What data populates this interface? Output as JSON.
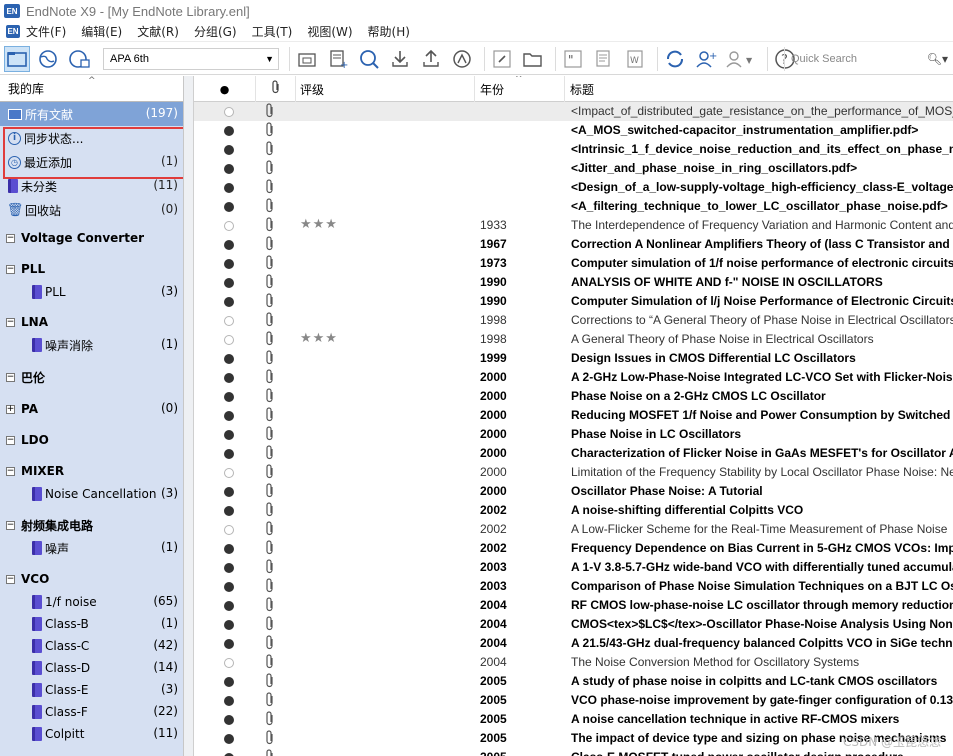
{
  "window": {
    "title": "EndNote X9 - [My EndNote Library.enl]",
    "icon_text": "EN"
  },
  "menu": [
    "文件(F)",
    "编辑(E)",
    "文献(R)",
    "分组(G)",
    "工具(T)",
    "视图(W)",
    "帮助(H)"
  ],
  "toolbar": {
    "style": "APA 6th",
    "search_placeholder": "Quick Search",
    "icons": [
      "local-library-icon",
      "online-search-icon",
      "integrated-library-icon",
      "new-group-icon",
      "new-reference-icon",
      "online-search-tool-icon",
      "import-icon",
      "export-icon",
      "find-fulltext-icon",
      "open-link-icon",
      "open-file-icon",
      "insert-citation-icon",
      "format-bibliography-icon",
      "word-icon",
      "sync-icon",
      "share-icon",
      "share-group-icon",
      "help-icon",
      "search-icon"
    ]
  },
  "sidebar": {
    "header": "我的库",
    "top_groups": [
      {
        "label": "所有文献",
        "count": "(197)",
        "icon": "library-icon"
      },
      {
        "label": "同步状态...",
        "count": "",
        "icon": "info-icon"
      },
      {
        "label": "最近添加",
        "count": "(1)",
        "icon": "clock-icon"
      },
      {
        "label": "未分类",
        "count": "(11)",
        "icon": "book-icon"
      },
      {
        "label": "回收站",
        "count": "(0)",
        "icon": "trash-icon"
      }
    ],
    "sets": [
      {
        "label": "Voltage Converter",
        "count": "",
        "expander": "−",
        "children": []
      },
      {
        "label": "PLL",
        "count": "",
        "expander": "−",
        "children": [
          {
            "label": "PLL",
            "count": "(3)"
          }
        ]
      },
      {
        "label": "LNA",
        "count": "",
        "expander": "−",
        "children": [
          {
            "label": "噪声消除",
            "count": "(1)"
          }
        ]
      },
      {
        "label": "巴伦",
        "count": "",
        "expander": "−",
        "children": []
      },
      {
        "label": "PA",
        "count": "(0)",
        "expander": "+",
        "children": []
      },
      {
        "label": "LDO",
        "count": "",
        "expander": "−",
        "children": []
      },
      {
        "label": "MIXER",
        "count": "",
        "expander": "−",
        "children": [
          {
            "label": "Noise Cancellation",
            "count": "(3)"
          }
        ]
      },
      {
        "label": "射频集成电路",
        "count": "",
        "expander": "−",
        "children": [
          {
            "label": "噪声",
            "count": "(1)"
          }
        ]
      },
      {
        "label": "VCO",
        "count": "",
        "expander": "−",
        "children": [
          {
            "label": "1/f noise",
            "count": "(65)"
          },
          {
            "label": "Class-B",
            "count": "(1)"
          },
          {
            "label": "Class-C",
            "count": "(42)"
          },
          {
            "label": "Class-D",
            "count": "(14)"
          },
          {
            "label": "Class-E",
            "count": "(3)"
          },
          {
            "label": "Class-F",
            "count": "(22)"
          },
          {
            "label": "Colpitt",
            "count": "(11)"
          }
        ]
      }
    ]
  },
  "list": {
    "columns": {
      "read": "●",
      "attachment": "📎",
      "rating": "评级",
      "year": "年份",
      "title": "标题"
    },
    "rows": [
      {
        "read": false,
        "rating": "",
        "year": "",
        "title": "<Impact_of_distributed_gate_resistance_on_the_performance_of_MOS_de",
        "bold": false
      },
      {
        "read": true,
        "rating": "",
        "year": "",
        "title": "<A_MOS_switched-capacitor_instrumentation_amplifier.pdf>",
        "bold": true
      },
      {
        "read": true,
        "rating": "",
        "year": "",
        "title": "<Intrinsic_1_f_device_noise_reduction_and_its_effect_on_phase_noise",
        "bold": true
      },
      {
        "read": true,
        "rating": "",
        "year": "",
        "title": "<Jitter_and_phase_noise_in_ring_oscillators.pdf>",
        "bold": true
      },
      {
        "read": true,
        "rating": "",
        "year": "",
        "title": "<Design_of_a_low-supply-voltage_high-efficiency_class-E_voltage-con",
        "bold": true
      },
      {
        "read": true,
        "rating": "",
        "year": "",
        "title": "<A_filtering_technique_to_lower_LC_oscillator_phase_noise.pdf>",
        "bold": true
      },
      {
        "read": false,
        "rating": "★★★",
        "year": "1933",
        "title": "The Interdependence of Frequency Variation and Harmonic Content and",
        "bold": false
      },
      {
        "read": true,
        "rating": "",
        "year": "1967",
        "title": "Correction A Nonlinear Amplifiers Theory of (lass C Transistor and Fre",
        "bold": true
      },
      {
        "read": true,
        "rating": "",
        "year": "1973",
        "title": "Computer simulation of 1/f noise performance of electronic circuits",
        "bold": true
      },
      {
        "read": true,
        "rating": "",
        "year": "1990",
        "title": "ANALYSIS OF WHITE AND f-\" NOISE IN OSCILLATORS",
        "bold": true
      },
      {
        "read": true,
        "rating": "",
        "year": "1990",
        "title": "Computer Simulation of l/j Noise Performance of Electronic Circuits",
        "bold": true
      },
      {
        "read": false,
        "rating": "",
        "year": "1998",
        "title": "Corrections to “A General Theory of Phase Noise in Electrical Oscillators”",
        "bold": false
      },
      {
        "read": false,
        "rating": "★★★",
        "year": "1998",
        "title": "A General Theory of Phase Noise in Electrical Oscillators",
        "bold": false
      },
      {
        "read": true,
        "rating": "",
        "year": "1999",
        "title": "Design Issues in CMOS Differential LC Oscillators",
        "bold": true
      },
      {
        "read": true,
        "rating": "",
        "year": "2000",
        "title": "A 2-GHz Low-Phase-Noise Integrated LC-VCO Set with Flicker-Noise",
        "bold": true
      },
      {
        "read": true,
        "rating": "",
        "year": "2000",
        "title": "Phase Noise on a 2-GHz CMOS LC Oscillator",
        "bold": true
      },
      {
        "read": true,
        "rating": "",
        "year": "2000",
        "title": "Reducing MOSFET 1/f Noise and Power Consumption by Switched Bia",
        "bold": true
      },
      {
        "read": true,
        "rating": "",
        "year": "2000",
        "title": "Phase Noise in LC Oscillators",
        "bold": true
      },
      {
        "read": true,
        "rating": "",
        "year": "2000",
        "title": "Characterization of Flicker Noise in GaAs MESFET's for Oscillator Appli",
        "bold": true
      },
      {
        "read": false,
        "rating": "",
        "year": "2000",
        "title": "Limitation of the Frequency Stability by Local Oscillator Phase Noise: New",
        "bold": false
      },
      {
        "read": true,
        "rating": "",
        "year": "2000",
        "title": "Oscillator Phase Noise: A Tutorial",
        "bold": true
      },
      {
        "read": true,
        "rating": "",
        "year": "2002",
        "title": "A noise-shifting differential Colpitts VCO",
        "bold": true
      },
      {
        "read": false,
        "rating": "",
        "year": "2002",
        "title": "A Low-Flicker Scheme for the Real-Time Measurement of Phase Noise",
        "bold": false
      },
      {
        "read": true,
        "rating": "",
        "year": "2002",
        "title": "Frequency Dependence on Bias Current in 5-GHz CMOS VCOs: Impact",
        "bold": true
      },
      {
        "read": true,
        "rating": "",
        "year": "2003",
        "title": "A 1-V 3.8-5.7-GHz wide-band VCO with differentially tuned accumula",
        "bold": true
      },
      {
        "read": true,
        "rating": "",
        "year": "2003",
        "title": "Comparison of Phase Noise Simulation Techniques on a BJT LC Oscillat",
        "bold": true
      },
      {
        "read": true,
        "rating": "",
        "year": "2004",
        "title": "RF CMOS low-phase-noise LC oscillator through memory reduction ta",
        "bold": true
      },
      {
        "read": true,
        "rating": "",
        "year": "2004",
        "title": "CMOS<tex>$LC$</tex>-Oscillator Phase-Noise Analysis Using Nonlin",
        "bold": true
      },
      {
        "read": true,
        "rating": "",
        "year": "2004",
        "title": "A 21.5/43-GHz dual-frequency balanced Colpitts VCO in SiGe technol",
        "bold": true
      },
      {
        "read": false,
        "rating": "",
        "year": "2004",
        "title": "The Noise Conversion Method for Oscillatory Systems",
        "bold": false
      },
      {
        "read": true,
        "rating": "",
        "year": "2005",
        "title": "A study of phase noise in colpitts and LC-tank CMOS oscillators",
        "bold": true
      },
      {
        "read": true,
        "rating": "",
        "year": "2005",
        "title": "VCO phase-noise improvement by gate-finger configuration of 0.13-/",
        "bold": true
      },
      {
        "read": true,
        "rating": "",
        "year": "2005",
        "title": "A noise cancellation technique in active RF-CMOS mixers",
        "bold": true
      },
      {
        "read": true,
        "rating": "",
        "year": "2005",
        "title": "The impact of device type and sizing on phase noise mechanisms",
        "bold": true
      },
      {
        "read": true,
        "rating": "",
        "year": "2005",
        "title": "Class-E MOSFET tuned power oscillator design procedure",
        "bold": true
      }
    ]
  },
  "watermark": "CSDN @玉昆悠悠"
}
